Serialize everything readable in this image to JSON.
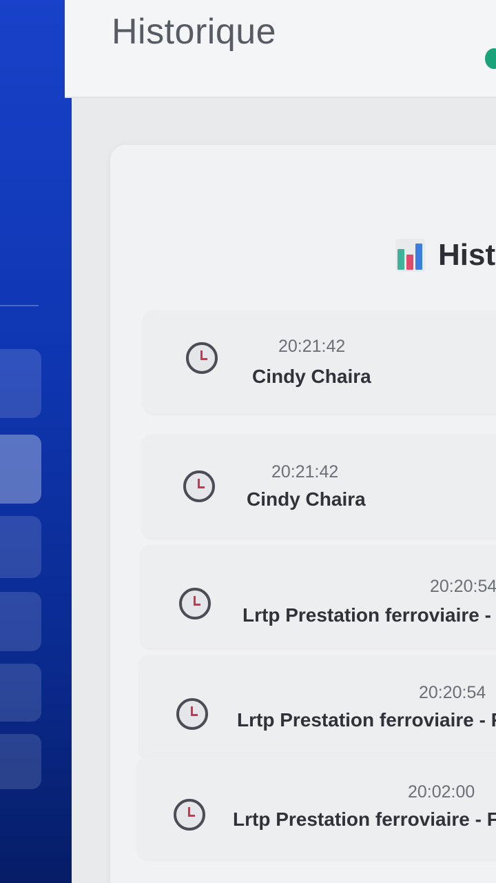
{
  "header": {
    "title": "Historique"
  },
  "panel": {
    "title": "Hist",
    "title_icon": "bar-chart-icon"
  },
  "history": [
    {
      "time": "20:21:42",
      "name": "Cindy Chaira",
      "icon": "clock-icon"
    },
    {
      "time": "20:21:42",
      "name": "Cindy Chaira",
      "icon": "clock-icon"
    },
    {
      "time": "20:20:54",
      "name": "Lrtp Prestation ferroviaire - F",
      "icon": "clock-icon"
    },
    {
      "time": "20:20:54",
      "name": "Lrtp Prestation ferroviaire - Fo",
      "icon": "clock-icon"
    },
    {
      "time": "20:02:00",
      "name": "Lrtp Prestation ferroviaire - Forr",
      "icon": "clock-icon"
    }
  ],
  "colors": {
    "sidebar": "#0f36b2",
    "clock_hand": "#d1344a",
    "accent_dot": "#18a37a"
  }
}
